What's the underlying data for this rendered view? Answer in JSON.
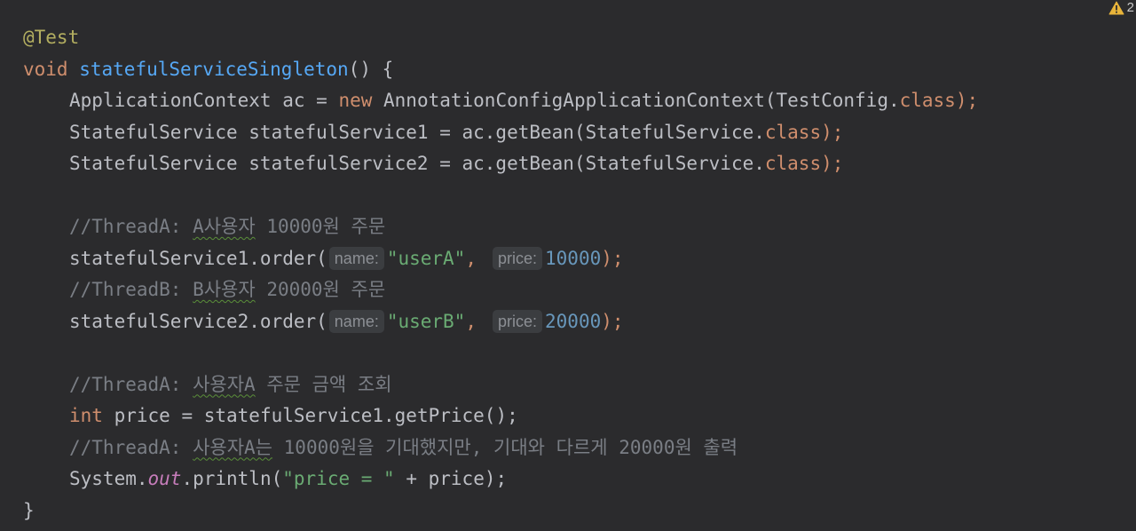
{
  "warnings": {
    "count": "2",
    "icon": "warning-icon"
  },
  "code": {
    "l1": {
      "ann": "@Test"
    },
    "l2": {
      "kw": "void",
      "sp": " ",
      "name": "statefulServiceSingleton",
      "rest": "() {"
    },
    "l3": {
      "a": "ApplicationContext ac = ",
      "kw": "new",
      "b": " AnnotationConfigApplicationContext(TestConfig.",
      "cls": "class",
      "c": ");"
    },
    "l4": {
      "a": "StatefulService statefulService1 = ac.getBean(StatefulService.",
      "cls": "class",
      "c": ");"
    },
    "l5": {
      "a": "StatefulService statefulService2 = ac.getBean(StatefulService.",
      "cls": "class",
      "c": ");"
    },
    "l7": {
      "a": "//ThreadA: ",
      "sq": "A사용자",
      "b": " 10000원 주문"
    },
    "l8": {
      "a": "statefulService1.order(",
      "hint1": "name:",
      "str": "\"userA\"",
      "comma": ",",
      "hint2": "price:",
      "num": "10000",
      "c": ");"
    },
    "l9": {
      "a": "//ThreadB: ",
      "sq": "B사용자",
      "b": " 20000원 주문"
    },
    "l10": {
      "a": "statefulService2.order(",
      "hint1": "name:",
      "str": "\"userB\"",
      "comma": ",",
      "hint2": "price:",
      "num": "20000",
      "c": ");"
    },
    "l12": {
      "a": "//ThreadA: ",
      "sq": "사용자A",
      "b": " 주문 금액 조회"
    },
    "l13": {
      "kw": "int",
      "a": " price = statefulService1.getPrice();"
    },
    "l14": {
      "a": "//ThreadA: ",
      "sq": "사용자A는",
      "b": " 10000원을 기대했지만, 기대와 다르게 20000원 출력"
    },
    "l15": {
      "a": "System.",
      "out": "out",
      "b": ".println(",
      "str": "\"price = \"",
      "c": " + price);"
    },
    "l16": {
      "a": "}"
    }
  }
}
